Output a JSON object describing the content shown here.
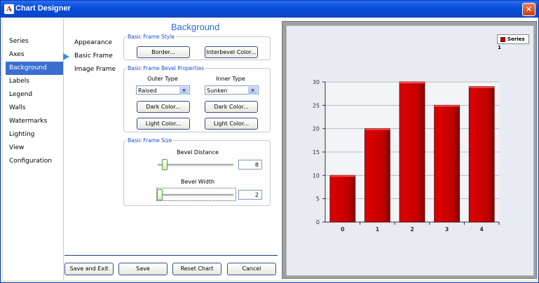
{
  "window": {
    "title": "Chart Designer",
    "app_icon": "A"
  },
  "nav": {
    "items": [
      {
        "label": "Series"
      },
      {
        "label": "Axes"
      },
      {
        "label": "Background"
      },
      {
        "label": "Labels"
      },
      {
        "label": "Legend"
      },
      {
        "label": "Walls"
      },
      {
        "label": "Watermarks"
      },
      {
        "label": "Lighting"
      },
      {
        "label": "View"
      },
      {
        "label": "Configuration"
      }
    ],
    "selected": "Background"
  },
  "page": {
    "heading": "Background",
    "subnav": [
      {
        "label": "Appearance"
      },
      {
        "label": "Basic Frame"
      },
      {
        "label": "Image Frame"
      }
    ],
    "subnav_selected": "Basic Frame"
  },
  "basic_frame_style": {
    "legend": "Basic Frame Style",
    "border_button": "Border...",
    "interbevel_button": "Interbevel Color..."
  },
  "bevel_properties": {
    "legend": "Basic Frame Bevel Properties",
    "outer_label": "Outer Type",
    "inner_label": "Inner Type",
    "outer_value": "Raised",
    "inner_value": "Sunken",
    "outer_dark": "Dark Color...",
    "inner_dark": "Dark Color...",
    "outer_light": "Light Color...",
    "inner_light": "Light Color..."
  },
  "frame_size": {
    "legend": "Basic Frame Size",
    "bevel_distance_label": "Bevel Distance",
    "bevel_distance_value": "8",
    "bevel_width_label": "Bevel Width",
    "bevel_width_value": "2"
  },
  "footer": {
    "save_exit": "Save and Exit",
    "save": "Save",
    "reset": "Reset Chart",
    "cancel": "Cancel"
  },
  "colors": {
    "accent": "#3a6fd0",
    "bar": "#c40000",
    "title_bar": "#0a4edc"
  },
  "chart_data": {
    "type": "bar",
    "categories": [
      "0",
      "1",
      "2",
      "3",
      "4"
    ],
    "series": [
      {
        "name": "Series 1",
        "values": [
          10,
          20,
          30,
          25,
          29
        ]
      }
    ],
    "ylim": [
      0,
      30
    ],
    "yticks": [
      "0",
      "5",
      "10",
      "15",
      "20",
      "25",
      "30"
    ],
    "grid": true,
    "legend_position": "top-right"
  }
}
